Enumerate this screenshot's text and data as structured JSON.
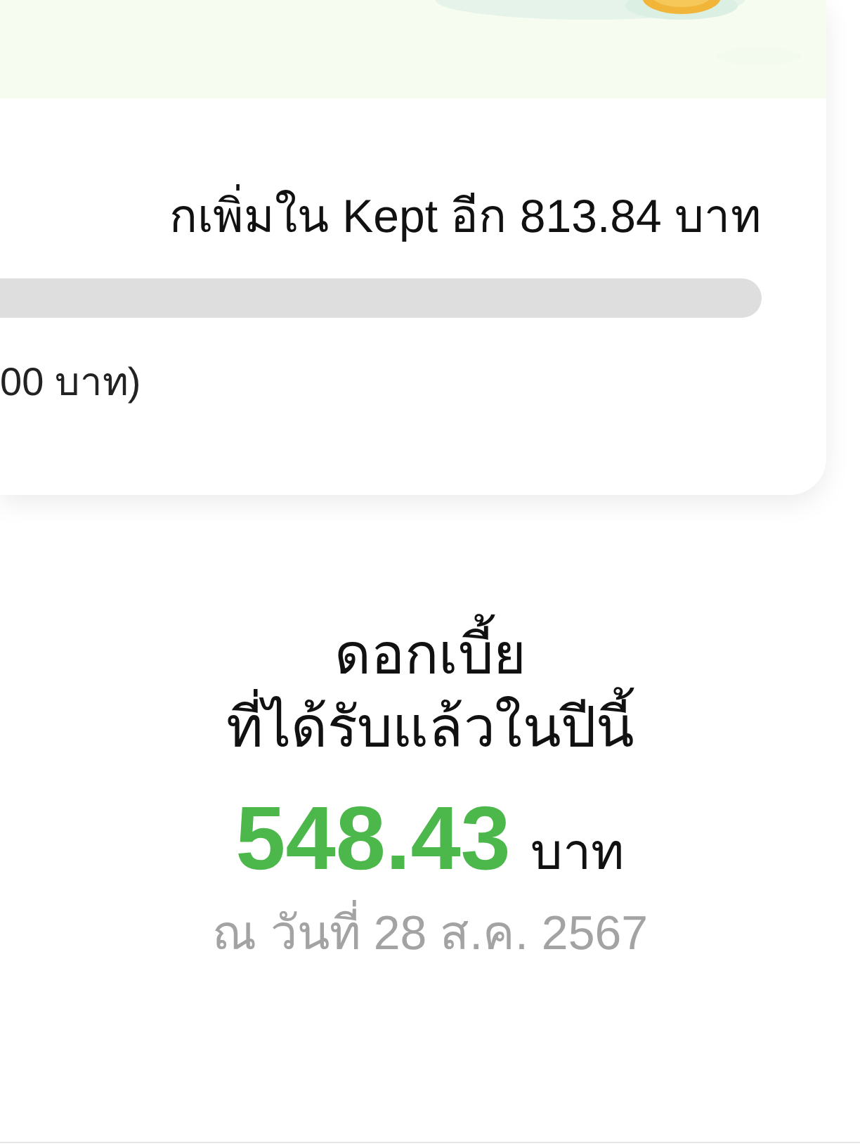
{
  "goal_card": {
    "kind": "picture",
    "message": "กเพิ่มใน Kept อีก 813.84 บาท",
    "progress_note": "00 บาท)"
  },
  "interest": {
    "title_lines": [
      "ดอกเบี้ย",
      "ที่ได้รับแล้วในปีนี้"
    ],
    "amount": "548.43",
    "currency": "บาท",
    "as_of": "ณ วันที่ 28 ส.ค. 2567"
  }
}
